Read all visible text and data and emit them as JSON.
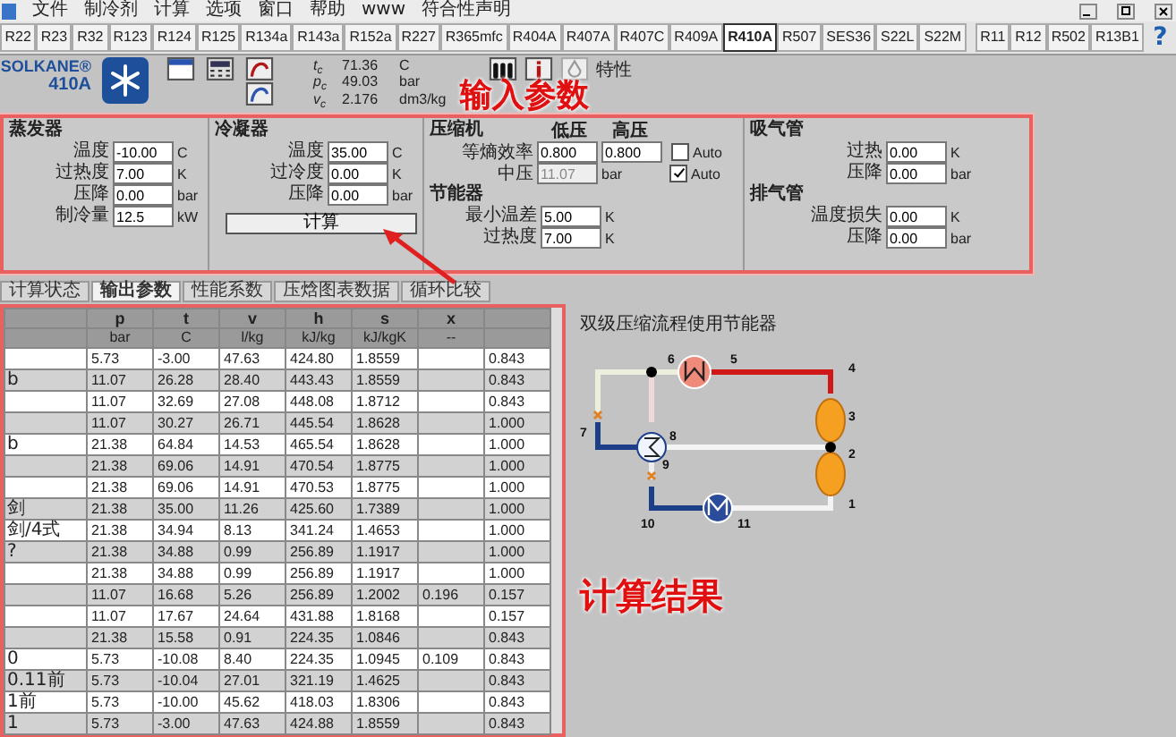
{
  "menu": {
    "items": [
      "文件",
      "制冷剂",
      "计算",
      "选项",
      "窗口",
      "帮助",
      "www",
      "符合性声明"
    ]
  },
  "refrigerants": [
    {
      "label": "R22",
      "selected": false
    },
    {
      "label": "R23",
      "selected": false
    },
    {
      "label": "R32",
      "selected": false
    },
    {
      "label": "R123",
      "selected": false
    },
    {
      "label": "R124",
      "selected": false
    },
    {
      "label": "R125",
      "selected": false
    },
    {
      "label": "R134a",
      "selected": false
    },
    {
      "label": "R143a",
      "selected": false
    },
    {
      "label": "R152a",
      "selected": false
    },
    {
      "label": "R227",
      "selected": false
    },
    {
      "label": "R365mfc",
      "selected": false
    },
    {
      "label": "R404A",
      "selected": false
    },
    {
      "label": "R407A",
      "selected": false
    },
    {
      "label": "R407C",
      "selected": false
    },
    {
      "label": "R409A",
      "selected": false
    },
    {
      "label": "R410A",
      "selected": true
    },
    {
      "label": "R507",
      "selected": false
    },
    {
      "label": "SES36",
      "selected": false
    },
    {
      "label": "S22L",
      "selected": false
    },
    {
      "label": "S22M",
      "selected": false
    }
  ],
  "legacy_refrigerants": [
    {
      "label": "R11",
      "selected": false
    },
    {
      "label": "R12",
      "selected": false
    },
    {
      "label": "R502",
      "selected": false
    },
    {
      "label": "R13B1",
      "selected": false
    }
  ],
  "help_button": "?",
  "header": {
    "brand": "SOLKANE®",
    "model": "410A",
    "props": [
      {
        "symbol": "t$_{c}$",
        "value": "71.36",
        "unit": "C"
      },
      {
        "symbol": "p$_{c}$",
        "value": "49.03",
        "unit": "bar"
      },
      {
        "symbol": "v$_{c}$",
        "value": "2.176",
        "unit": "dm3/kg"
      }
    ],
    "feature_label": "特性"
  },
  "annotation_input": "输入参数",
  "evaporator": {
    "title": "蒸发器",
    "fields": [
      {
        "label": "温度",
        "value": "-10.00",
        "unit": "C"
      },
      {
        "label": "过热度",
        "value": "7.00",
        "unit": "K"
      },
      {
        "label": "压降",
        "value": "0.00",
        "unit": "bar"
      },
      {
        "label": "制冷量",
        "value": "12.5",
        "unit": "kW"
      }
    ]
  },
  "condenser": {
    "title": "冷凝器",
    "fields": [
      {
        "label": "温度",
        "value": "35.00",
        "unit": "C"
      },
      {
        "label": "过冷度",
        "value": "0.00",
        "unit": "K"
      },
      {
        "label": "压降",
        "value": "0.00",
        "unit": "bar"
      }
    ],
    "button": "计算"
  },
  "compressor": {
    "title": "压缩机",
    "col_low": "低压",
    "col_high": "高压",
    "efficiency": {
      "label": "等熵效率",
      "low": "0.800",
      "high": "0.800",
      "auto_label": "Auto",
      "auto_checked": false
    },
    "mid": {
      "label": "中压",
      "value": "11.07",
      "unit": "bar",
      "disabled": true,
      "auto_label": "Auto",
      "auto_checked": true
    }
  },
  "economizer": {
    "title": "节能器",
    "fields": [
      {
        "label": "最小温差",
        "value": "5.00",
        "unit": "K"
      },
      {
        "label": "过热度",
        "value": "7.00",
        "unit": "K"
      }
    ]
  },
  "suction_line": {
    "title": "吸气管",
    "fields": [
      {
        "label": "过热",
        "value": "0.00",
        "unit": "K"
      },
      {
        "label": "压降",
        "value": "0.00",
        "unit": "bar"
      }
    ]
  },
  "discharge_line": {
    "title": "排气管",
    "fields": [
      {
        "label": "温度损失",
        "value": "0.00",
        "unit": "K"
      },
      {
        "label": "压降",
        "value": "0.00",
        "unit": "bar"
      }
    ]
  },
  "output_tabs": [
    {
      "label": "计算状态",
      "selected": false
    },
    {
      "label": "输出参数",
      "selected": true
    },
    {
      "label": "性能系数",
      "selected": false
    },
    {
      "label": "压焓图表数据",
      "selected": false
    },
    {
      "label": "循环比较",
      "selected": false
    }
  ],
  "table": {
    "columns": [
      {
        "name": "p",
        "unit": "bar"
      },
      {
        "name": "t",
        "unit": "C"
      },
      {
        "name": "v",
        "unit": "l/kg"
      },
      {
        "name": "h",
        "unit": "kJ/kg"
      },
      {
        "name": "s",
        "unit": "kJ/kgK"
      },
      {
        "name": "x",
        "unit": "--"
      }
    ],
    "rows": [
      {
        "cells": [
          "5.73",
          "-3.00",
          "47.63",
          "424.80",
          "1.8559",
          null,
          "0.843"
        ]
      },
      {
        "label": "b",
        "cells": [
          "11.07",
          "26.28",
          "28.40",
          "443.43",
          "1.8559",
          null,
          "0.843"
        ]
      },
      {
        "cells": [
          "11.07",
          "32.69",
          "27.08",
          "448.08",
          "1.8712",
          null,
          "0.843"
        ]
      },
      {
        "cells": [
          "11.07",
          "30.27",
          "26.71",
          "445.54",
          "1.8628",
          null,
          "1.000"
        ]
      },
      {
        "label": "b",
        "cells": [
          "21.38",
          "64.84",
          "14.53",
          "465.54",
          "1.8628",
          null,
          "1.000"
        ]
      },
      {
        "cells": [
          "21.38",
          "69.06",
          "14.91",
          "470.54",
          "1.8775",
          null,
          "1.000"
        ]
      },
      {
        "cells": [
          "21.38",
          "69.06",
          "14.91",
          "470.53",
          "1.8775",
          null,
          "1.000"
        ]
      },
      {
        "label": "剑",
        "cells": [
          "21.38",
          "35.00",
          "11.26",
          "425.60",
          "1.7389",
          null,
          "1.000"
        ]
      },
      {
        "label": "剑/4式",
        "cells": [
          "21.38",
          "34.94",
          "8.13",
          "341.24",
          "1.4653",
          null,
          "1.000"
        ]
      },
      {
        "label": "?",
        "cells": [
          "21.38",
          "34.88",
          "0.99",
          "256.89",
          "1.1917",
          null,
          "1.000"
        ]
      },
      {
        "cells": [
          "21.38",
          "34.88",
          "0.99",
          "256.89",
          "1.1917",
          null,
          "1.000"
        ]
      },
      {
        "cells": [
          "11.07",
          "16.68",
          "5.26",
          "256.89",
          "1.2002",
          "0.196",
          "0.157"
        ]
      },
      {
        "cells": [
          "11.07",
          "17.67",
          "24.64",
          "431.88",
          "1.8168",
          null,
          "0.157"
        ]
      },
      {
        "cells": [
          "21.38",
          "15.58",
          "0.91",
          "224.35",
          "1.0846",
          null,
          "0.843"
        ]
      },
      {
        "label": "0",
        "cells": [
          "5.73",
          "-10.08",
          "8.40",
          "224.35",
          "1.0945",
          "0.109",
          "0.843"
        ]
      },
      {
        "label": "0.11前",
        "cells": [
          "5.73",
          "-10.04",
          "27.01",
          "321.19",
          "1.4625",
          null,
          "0.843"
        ]
      },
      {
        "label": "1前",
        "cells": [
          "5.73",
          "-10.00",
          "45.62",
          "418.03",
          "1.8306",
          null,
          "0.843"
        ]
      },
      {
        "label": "1",
        "cells": [
          "5.73",
          "-3.00",
          "47.63",
          "424.88",
          "1.8559",
          null,
          "0.843"
        ]
      }
    ]
  },
  "diagram": {
    "title": "双级压缩流程使用节能器",
    "point_labels": [
      "6",
      "5",
      "4",
      "3",
      "7",
      "8",
      "2",
      "9",
      "1",
      "10",
      "11"
    ]
  },
  "annotation_result": "计算结果"
}
